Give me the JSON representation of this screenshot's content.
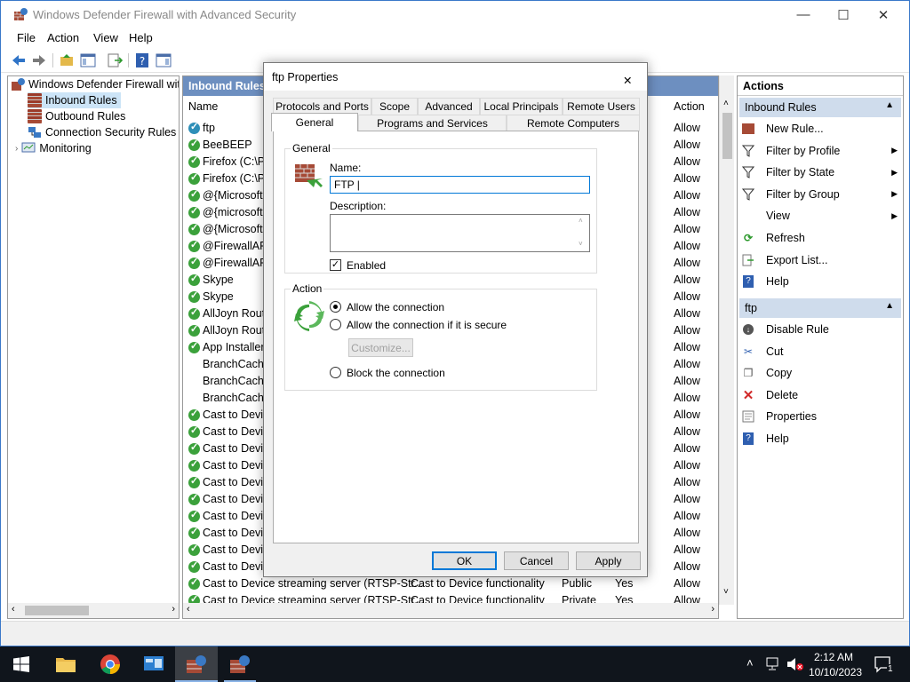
{
  "window": {
    "title": "Windows Defender Firewall with Advanced Security",
    "controls": {
      "minimize": "—",
      "maximize": "☐",
      "close": "✕"
    }
  },
  "menu": [
    "File",
    "Action",
    "View",
    "Help"
  ],
  "tree": {
    "root": "Windows Defender Firewall with Advanced Security",
    "items": [
      "Inbound Rules",
      "Outbound Rules",
      "Connection Security Rules",
      "Monitoring"
    ]
  },
  "center": {
    "header": "Inbound Rules",
    "columns": {
      "name": "Name",
      "action": "Action"
    },
    "rows": [
      {
        "name": "ftp",
        "group": "",
        "profile": "",
        "enabled": "",
        "action": "Allow",
        "icon": "check-blue"
      },
      {
        "name": "BeeBEEP",
        "group": "",
        "profile": "",
        "enabled": "",
        "action": "Allow",
        "icon": "check"
      },
      {
        "name": "Firefox (C:\\Pr",
        "group": "",
        "profile": "",
        "enabled": "",
        "action": "Allow",
        "icon": "check"
      },
      {
        "name": "Firefox (C:\\Pr",
        "group": "",
        "profile": "",
        "enabled": "",
        "action": "Allow",
        "icon": "check"
      },
      {
        "name": "@{Microsoft.",
        "group": "",
        "profile": "",
        "enabled": "",
        "action": "Allow",
        "icon": "check"
      },
      {
        "name": "@{microsoft.",
        "group": "",
        "profile": "",
        "enabled": "",
        "action": "Allow",
        "icon": "check"
      },
      {
        "name": "@{Microsoft.",
        "group": "",
        "profile": "",
        "enabled": "",
        "action": "Allow",
        "icon": "check"
      },
      {
        "name": "@FirewallAPI.",
        "group": "",
        "profile": "",
        "enabled": "",
        "action": "Allow",
        "icon": "check"
      },
      {
        "name": "@FirewallAPI.",
        "group": "",
        "profile": "",
        "enabled": "",
        "action": "Allow",
        "icon": "check"
      },
      {
        "name": "Skype",
        "group": "",
        "profile": "",
        "enabled": "",
        "action": "Allow",
        "icon": "check"
      },
      {
        "name": "Skype",
        "group": "",
        "profile": "",
        "enabled": "",
        "action": "Allow",
        "icon": "check"
      },
      {
        "name": "AllJoyn Route",
        "group": "",
        "profile": "",
        "enabled": "",
        "action": "Allow",
        "icon": "check"
      },
      {
        "name": "AllJoyn Route",
        "group": "",
        "profile": "",
        "enabled": "",
        "action": "Allow",
        "icon": "check"
      },
      {
        "name": "App Installer",
        "group": "",
        "profile": "",
        "enabled": "",
        "action": "Allow",
        "icon": "check"
      },
      {
        "name": "BranchCache",
        "group": "",
        "profile": "",
        "enabled": "",
        "action": "Allow",
        "icon": "none"
      },
      {
        "name": "BranchCache",
        "group": "",
        "profile": "",
        "enabled": "",
        "action": "Allow",
        "icon": "none"
      },
      {
        "name": "BranchCache",
        "group": "",
        "profile": "",
        "enabled": "",
        "action": "Allow",
        "icon": "none"
      },
      {
        "name": "Cast to Device",
        "group": "",
        "profile": "",
        "enabled": "",
        "action": "Allow",
        "icon": "check"
      },
      {
        "name": "Cast to Device",
        "group": "",
        "profile": "",
        "enabled": "",
        "action": "Allow",
        "icon": "check"
      },
      {
        "name": "Cast to Device",
        "group": "",
        "profile": "",
        "enabled": "",
        "action": "Allow",
        "icon": "check"
      },
      {
        "name": "Cast to Device",
        "group": "",
        "profile": "",
        "enabled": "",
        "action": "Allow",
        "icon": "check"
      },
      {
        "name": "Cast to Device",
        "group": "",
        "profile": "",
        "enabled": "",
        "action": "Allow",
        "icon": "check"
      },
      {
        "name": "Cast to Device",
        "group": "",
        "profile": "",
        "enabled": "",
        "action": "Allow",
        "icon": "check"
      },
      {
        "name": "Cast to Device",
        "group": "",
        "profile": "",
        "enabled": "",
        "action": "Allow",
        "icon": "check"
      },
      {
        "name": "Cast to Device",
        "group": "",
        "profile": "",
        "enabled": "",
        "action": "Allow",
        "icon": "check"
      },
      {
        "name": "Cast to Device",
        "group": "",
        "profile": "",
        "enabled": "",
        "action": "Allow",
        "icon": "check"
      },
      {
        "name": "Cast to Device",
        "group": "",
        "profile": "",
        "enabled": "",
        "action": "Allow",
        "icon": "check"
      },
      {
        "name": "Cast to Device streaming server (RTSP-Str...",
        "group": "Cast to Device functionality",
        "profile": "Public",
        "enabled": "Yes",
        "action": "Allow",
        "icon": "check"
      },
      {
        "name": "Cast to Device streaming server (RTSP-Str...",
        "group": "Cast to Device functionality",
        "profile": "Private",
        "enabled": "Yes",
        "action": "Allow",
        "icon": "check"
      }
    ]
  },
  "actions": {
    "header": "Actions",
    "section1": "Inbound Rules",
    "items1": [
      {
        "label": "New Rule...",
        "icon": "new-rule-icon",
        "arrow": false
      },
      {
        "label": "Filter by Profile",
        "icon": "filter-icon",
        "arrow": true
      },
      {
        "label": "Filter by State",
        "icon": "filter-icon",
        "arrow": true
      },
      {
        "label": "Filter by Group",
        "icon": "filter-icon",
        "arrow": true
      },
      {
        "label": "View",
        "icon": "",
        "arrow": true
      },
      {
        "label": "Refresh",
        "icon": "refresh-icon",
        "arrow": false
      },
      {
        "label": "Export List...",
        "icon": "export-icon",
        "arrow": false
      },
      {
        "label": "Help",
        "icon": "help-icon",
        "arrow": false
      }
    ],
    "section2": "ftp",
    "items2": [
      {
        "label": "Disable Rule",
        "icon": "disable-icon"
      },
      {
        "label": "Cut",
        "icon": "cut-icon"
      },
      {
        "label": "Copy",
        "icon": "copy-icon"
      },
      {
        "label": "Delete",
        "icon": "delete-icon"
      },
      {
        "label": "Properties",
        "icon": "properties-icon"
      },
      {
        "label": "Help",
        "icon": "help-icon"
      }
    ]
  },
  "dialog": {
    "title": "ftp Properties",
    "tabs_row1": [
      "Protocols and Ports",
      "Scope",
      "Advanced",
      "Local Principals",
      "Remote Users"
    ],
    "tabs_row2": [
      "General",
      "Programs and Services",
      "Remote Computers"
    ],
    "active_tab": "General",
    "general_group": "General",
    "name_label": "Name:",
    "name_value": "FTP |",
    "description_label": "Description:",
    "description_value": "",
    "enabled_label": "Enabled",
    "enabled": true,
    "action_group": "Action",
    "radio_allow": "Allow the connection",
    "radio_secure": "Allow the connection if it is secure",
    "customize": "Customize...",
    "radio_block": "Block the connection",
    "selected_action": "allow",
    "buttons": {
      "ok": "OK",
      "cancel": "Cancel",
      "apply": "Apply"
    }
  },
  "taskbar": {
    "time": "2:12 AM",
    "date": "10/10/2023",
    "notifications_count": "1"
  },
  "colors": {
    "accent": "#0078d7",
    "header_blue": "#6d8fc0",
    "section_blue": "#cfdcec",
    "allow_green": "#3ba13b"
  }
}
